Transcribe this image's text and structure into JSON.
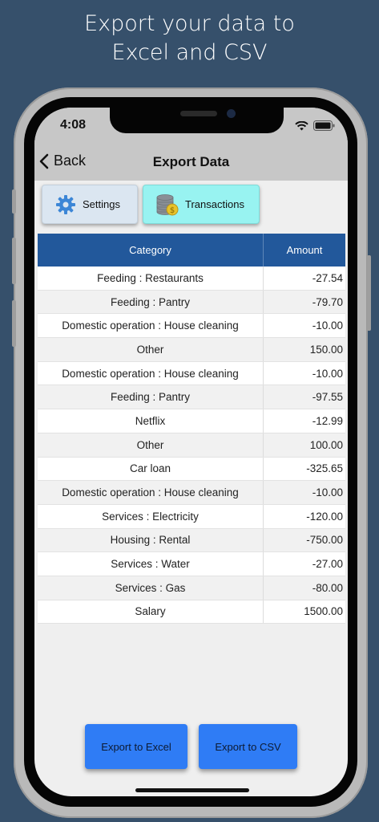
{
  "headline": {
    "line1": "Export your data to",
    "line2": "Excel and CSV"
  },
  "status": {
    "time": "4:08"
  },
  "nav": {
    "back_label": "Back",
    "title": "Export Data"
  },
  "tabs": {
    "settings_label": "Settings",
    "transactions_label": "Transactions"
  },
  "table": {
    "headers": {
      "category": "Category",
      "amount": "Amount"
    },
    "rows": [
      {
        "category": "Feeding : Restaurants",
        "amount": "-27.54"
      },
      {
        "category": "Feeding : Pantry",
        "amount": "-79.70"
      },
      {
        "category": "Domestic operation : House cleaning",
        "amount": "-10.00"
      },
      {
        "category": "Other",
        "amount": "150.00"
      },
      {
        "category": "Domestic operation : House cleaning",
        "amount": "-10.00"
      },
      {
        "category": "Feeding : Pantry",
        "amount": "-97.55"
      },
      {
        "category": "Netflix",
        "amount": "-12.99"
      },
      {
        "category": "Other",
        "amount": "100.00"
      },
      {
        "category": "Car loan",
        "amount": "-325.65"
      },
      {
        "category": "Domestic operation : House cleaning",
        "amount": "-10.00"
      },
      {
        "category": "Services : Electricity",
        "amount": "-120.00"
      },
      {
        "category": "Housing : Rental",
        "amount": "-750.00"
      },
      {
        "category": "Services : Water",
        "amount": "-27.00"
      },
      {
        "category": "Services : Gas",
        "amount": "-80.00"
      },
      {
        "category": "Salary",
        "amount": "1500.00"
      }
    ]
  },
  "actions": {
    "excel_label": "Export to Excel",
    "csv_label": "Export to CSV"
  },
  "colors": {
    "background": "#36506b",
    "table_header": "#22589b",
    "export_button": "#2f7cf5",
    "settings_tab": "#dbe6f1",
    "transactions_tab": "#98f3f1"
  },
  "icons": {
    "settings": "gear-icon",
    "transactions": "coins-icon",
    "back": "chevron-left-icon"
  }
}
